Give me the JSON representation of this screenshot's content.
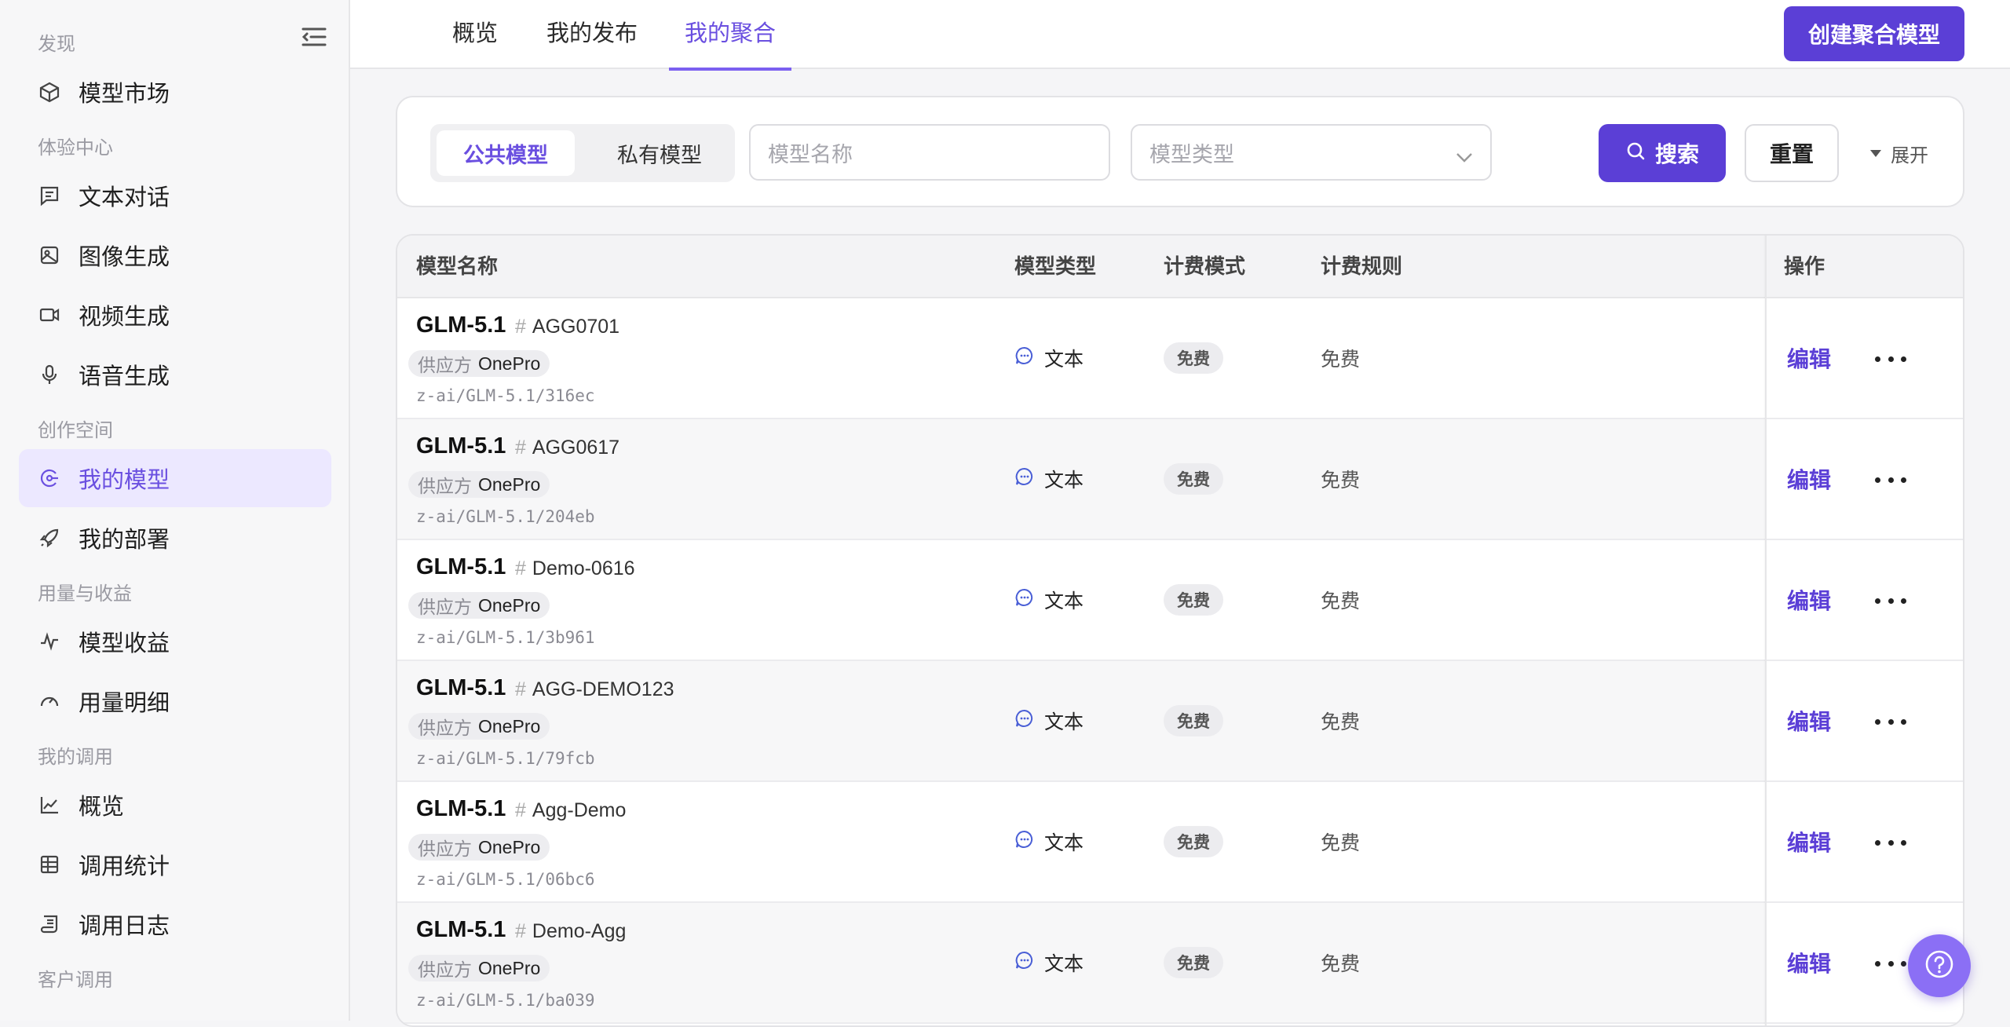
{
  "sidebar": {
    "sections": [
      {
        "label": "发现"
      },
      {
        "label": "体验中心"
      },
      {
        "label": "创作空间"
      },
      {
        "label": "用量与收益"
      },
      {
        "label": "我的调用"
      },
      {
        "label": "客户调用"
      }
    ],
    "items": [
      {
        "label": "模型市场",
        "icon": "cube-icon"
      },
      {
        "label": "文本对话",
        "icon": "chat-icon"
      },
      {
        "label": "图像生成",
        "icon": "image-icon"
      },
      {
        "label": "视频生成",
        "icon": "video-icon"
      },
      {
        "label": "语音生成",
        "icon": "mic-icon"
      },
      {
        "label": "我的模型",
        "icon": "model-icon",
        "active": true
      },
      {
        "label": "我的部署",
        "icon": "rocket-icon"
      },
      {
        "label": "模型收益",
        "icon": "pulse-icon"
      },
      {
        "label": "用量明细",
        "icon": "gauge-icon"
      },
      {
        "label": "概览",
        "icon": "line-chart-icon"
      },
      {
        "label": "调用统计",
        "icon": "table-icon"
      },
      {
        "label": "调用日志",
        "icon": "log-icon"
      }
    ]
  },
  "header": {
    "tabs": [
      {
        "label": "概览"
      },
      {
        "label": "我的发布"
      },
      {
        "label": "我的聚合",
        "active": true
      }
    ],
    "create_label": "创建聚合模型"
  },
  "filter": {
    "seg_public": "公共模型",
    "seg_private": "私有模型",
    "name_placeholder": "模型名称",
    "type_placeholder": "模型类型",
    "search_label": "搜索",
    "reset_label": "重置",
    "expand_label": "展开"
  },
  "table": {
    "columns": [
      "模型名称",
      "模型类型",
      "计费模式",
      "计费规则",
      "操作"
    ],
    "rows": [
      {
        "name": "GLM-5.1",
        "code": "AGG0701",
        "provider_label": "供应方",
        "provider": "OnePro",
        "path": "z-ai/GLM-5.1/316ec",
        "type": "文本",
        "billing_mode": "免费",
        "billing_rule": "免费",
        "edit": "编辑"
      },
      {
        "name": "GLM-5.1",
        "code": "AGG0617",
        "provider_label": "供应方",
        "provider": "OnePro",
        "path": "z-ai/GLM-5.1/204eb",
        "type": "文本",
        "billing_mode": "免费",
        "billing_rule": "免费",
        "edit": "编辑"
      },
      {
        "name": "GLM-5.1",
        "code": "Demo-0616",
        "provider_label": "供应方",
        "provider": "OnePro",
        "path": "z-ai/GLM-5.1/3b961",
        "type": "文本",
        "billing_mode": "免费",
        "billing_rule": "免费",
        "edit": "编辑"
      },
      {
        "name": "GLM-5.1",
        "code": "AGG-DEMO123",
        "provider_label": "供应方",
        "provider": "OnePro",
        "path": "z-ai/GLM-5.1/79fcb",
        "type": "文本",
        "billing_mode": "免费",
        "billing_rule": "免费",
        "edit": "编辑"
      },
      {
        "name": "GLM-5.1",
        "code": "Agg-Demo",
        "provider_label": "供应方",
        "provider": "OnePro",
        "path": "z-ai/GLM-5.1/06bc6",
        "type": "文本",
        "billing_mode": "免费",
        "billing_rule": "免费",
        "edit": "编辑"
      },
      {
        "name": "GLM-5.1",
        "code": "Demo-Agg",
        "provider_label": "供应方",
        "provider": "OnePro",
        "path": "z-ai/GLM-5.1/ba039",
        "type": "文本",
        "billing_mode": "免费",
        "billing_rule": "免费",
        "edit": "编辑"
      }
    ]
  },
  "colors": {
    "accent": "#5b3fd6",
    "accent_light": "#ece8ff",
    "type_icon": "#4a5fd6"
  }
}
